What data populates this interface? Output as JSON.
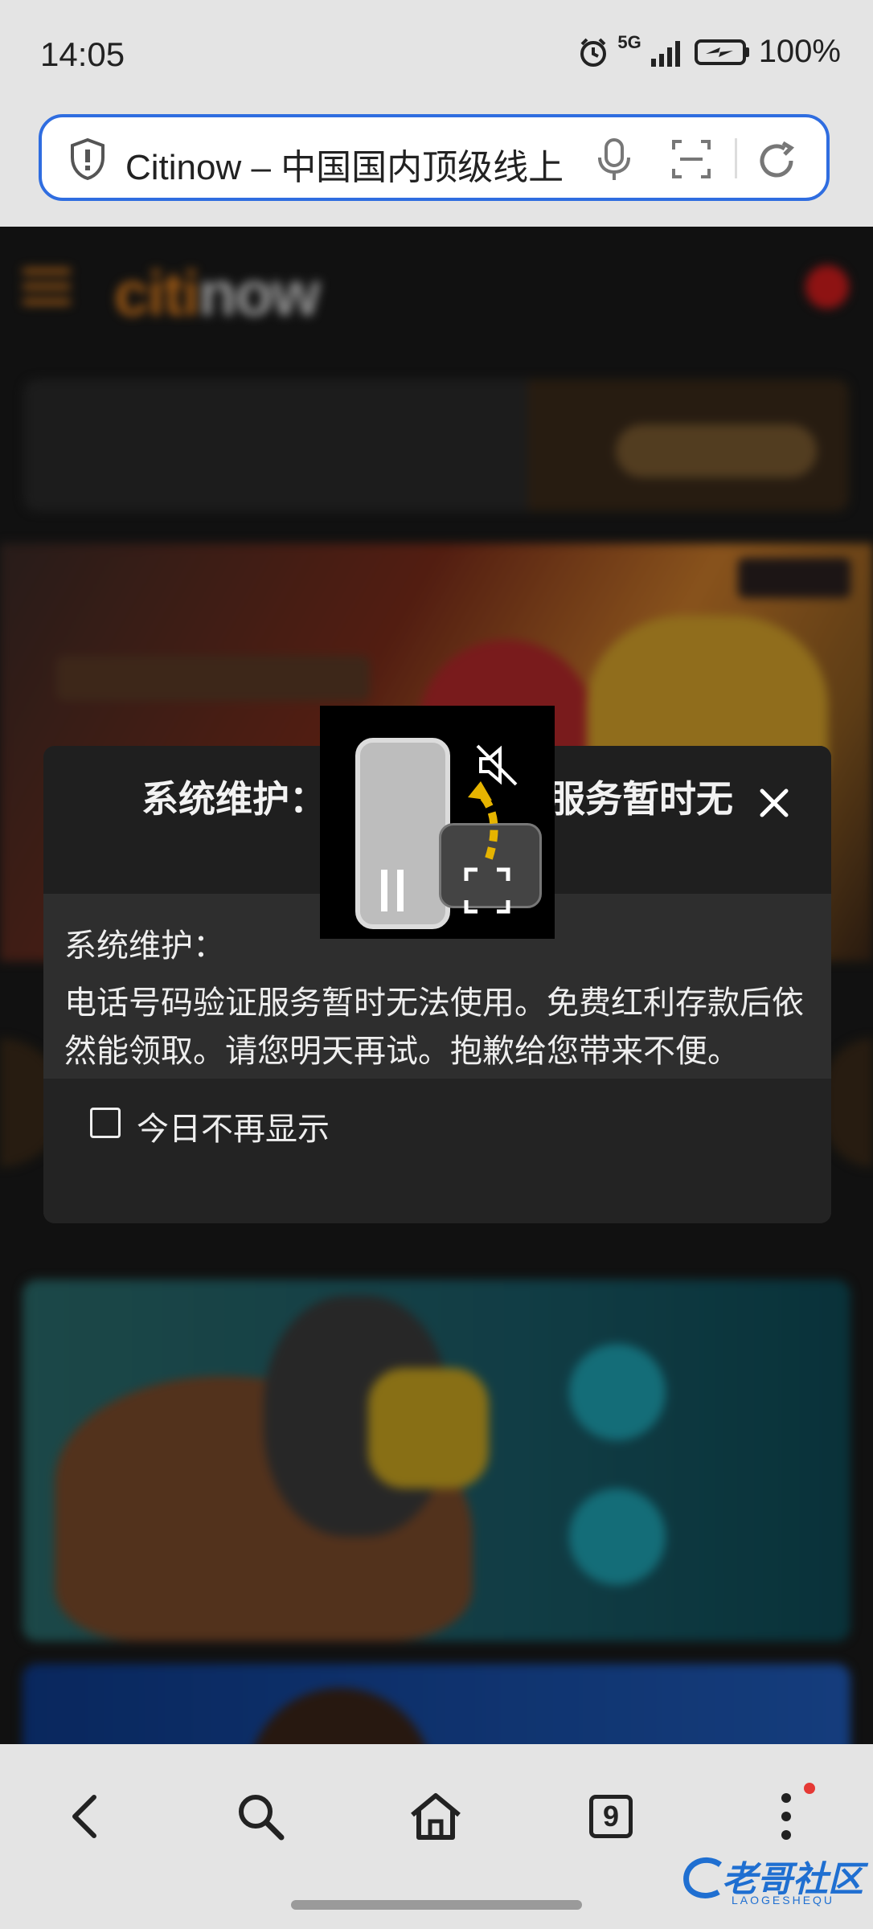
{
  "status_bar": {
    "time": "14:05",
    "network": "5G",
    "battery": "100%"
  },
  "browser": {
    "url_title": "Citinow – 中国国内顶级线上"
  },
  "page": {
    "logo_part1": "citi",
    "logo_part2": "now"
  },
  "modal": {
    "title": "系统维护：电话号码验证服务暂时无",
    "subtitle": "系统维护：",
    "message": "电话号码验证服务暂时无法使用。免费红利存款后依然能领取。请您明天再试。抱歉给您带来不便。",
    "checkbox_label": "今日不再显示"
  },
  "bottom_nav": {
    "tabs_count": "9"
  },
  "watermark": {
    "text": "老哥社区",
    "sub": "LAOGESHEQU"
  }
}
